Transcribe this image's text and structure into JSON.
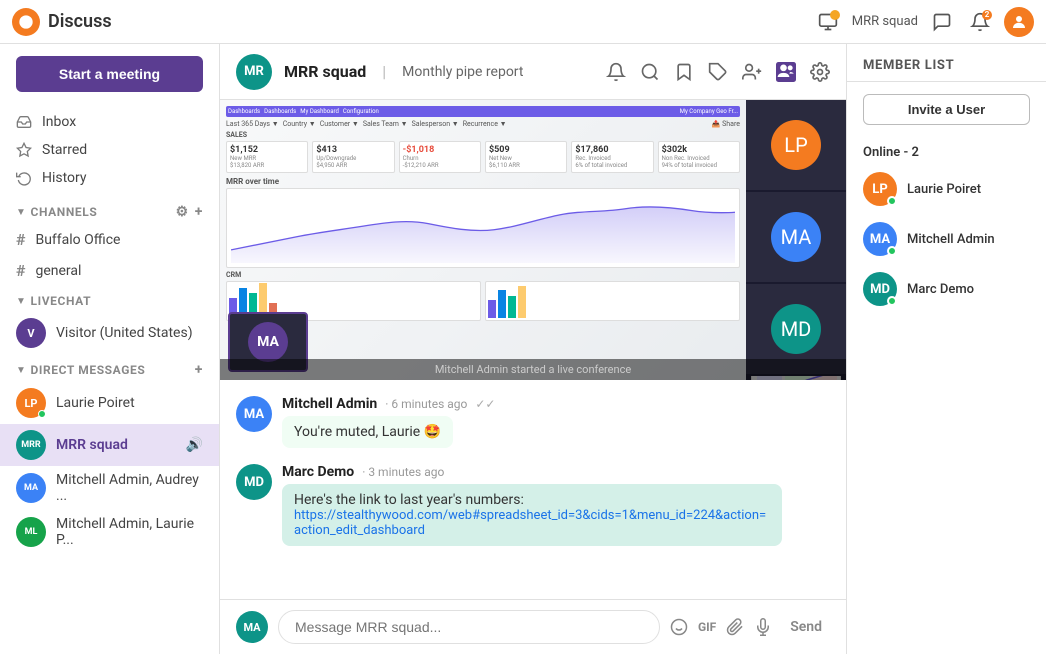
{
  "topbar": {
    "app_name": "Discuss",
    "current_channel": "MRR squad",
    "logo_color": "#f47b20"
  },
  "sidebar": {
    "start_meeting_label": "Start a meeting",
    "inbox_label": "Inbox",
    "starred_label": "Starred",
    "history_label": "History",
    "channels_label": "CHANNELS",
    "livechat_label": "LIVECHAT",
    "direct_messages_label": "DIRECT MESSAGES",
    "channels": [
      {
        "name": "Buffalo Office",
        "id": "buffalo-office"
      },
      {
        "name": "general",
        "id": "general"
      }
    ],
    "livechat": [
      {
        "name": "Visitor (United States)",
        "id": "visitor-us"
      }
    ],
    "direct_messages": [
      {
        "name": "Laurie Poiret",
        "id": "laurie-poiret",
        "online": true
      },
      {
        "name": "MRR squad",
        "id": "mrr-squad",
        "active": true,
        "muted": true
      },
      {
        "name": "Mitchell Admin, Audrey ...",
        "id": "mitchell-audrey"
      },
      {
        "name": "Mitchell Admin, Laurie P...",
        "id": "mitchell-laurie"
      }
    ]
  },
  "chat": {
    "channel_name": "MRR squad",
    "channel_subtitle": "Monthly pipe report",
    "conference_status": "Mitchell Admin started a live conference",
    "messages": [
      {
        "author": "Mitchell Admin",
        "time": "6 minutes ago",
        "text": "You're muted, Laurie 🤩",
        "avatar_color": "#3b82f6",
        "initials": "MA"
      },
      {
        "author": "Marc Demo",
        "time": "3 minutes ago",
        "text_plain": "Here's the link to last year's numbers:",
        "link": "https://stealthywood.com/web#spreadsheet_id=3&cids=1&menu_id=224&action=action_edit_dashboard",
        "avatar_color": "#0d9488",
        "initials": "MD"
      }
    ],
    "input_placeholder": "Message MRR squad...",
    "send_label": "Send"
  },
  "member_list": {
    "header": "MEMBER LIST",
    "invite_button": "Invite a User",
    "online_label": "Online - 2",
    "members": [
      {
        "name": "Laurie Poiret",
        "initials": "LP",
        "color": "#f47b20",
        "online": true
      },
      {
        "name": "Mitchell Admin",
        "initials": "MA",
        "color": "#3b82f6",
        "online": true
      },
      {
        "name": "Marc Demo",
        "initials": "MD",
        "color": "#0d9488",
        "online": false
      }
    ]
  }
}
